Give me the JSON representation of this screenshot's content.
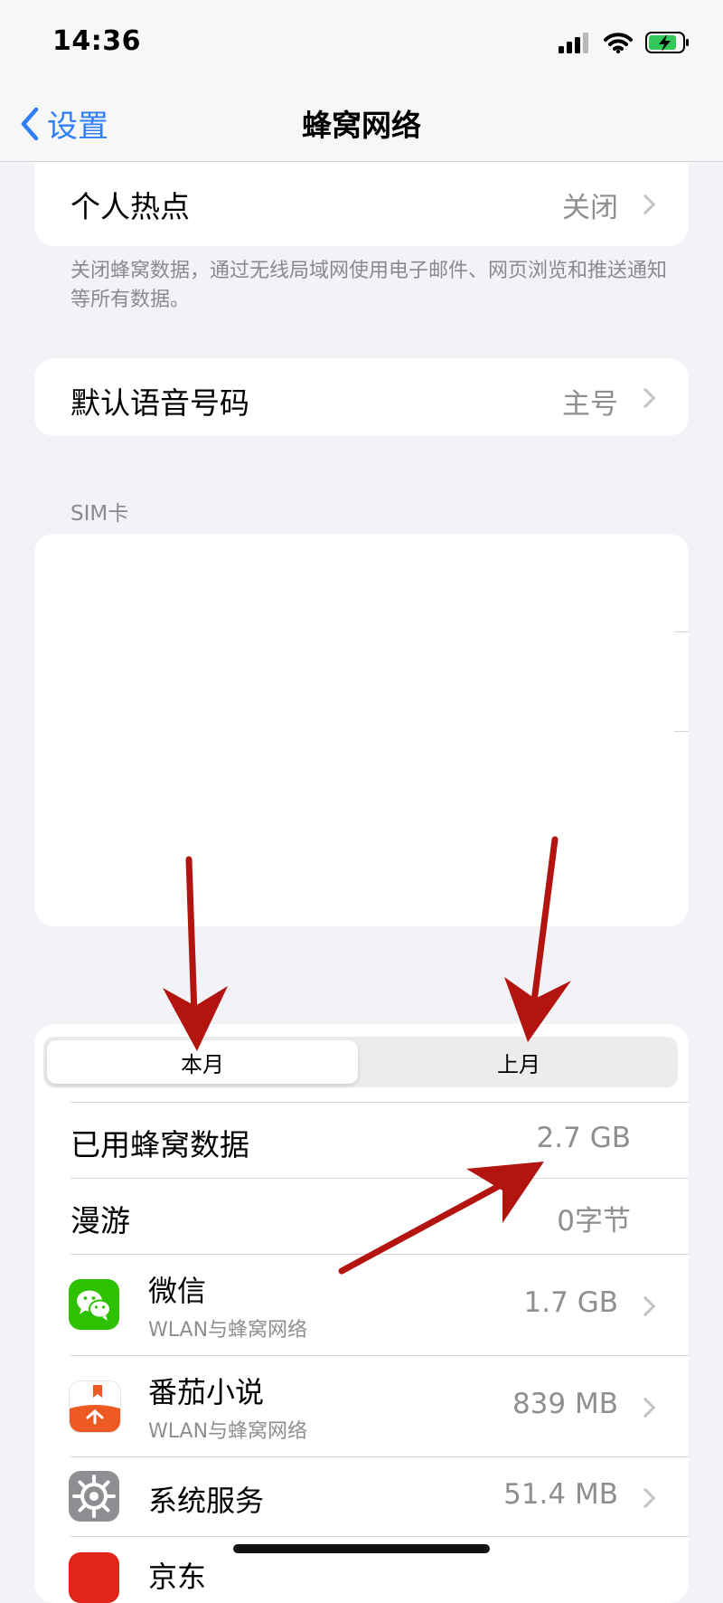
{
  "status_bar": {
    "time": "14:36"
  },
  "nav": {
    "back_label": "设置",
    "title": "蜂窝网络"
  },
  "hotspot": {
    "label": "个人热点",
    "value": "关闭"
  },
  "cellular_footnote": "关闭蜂窝数据，通过无线局域网使用电子邮件、网页浏览和推送通知等所有数据。",
  "voice": {
    "label": "默认语音号码",
    "value": "主号"
  },
  "sim_section": {
    "header": "SIM卡"
  },
  "usage": {
    "tabs": [
      {
        "label": "本月",
        "selected": true
      },
      {
        "label": "上月",
        "selected": false
      }
    ],
    "used": {
      "label": "已用蜂窝数据",
      "value": "2.7 GB"
    },
    "roaming": {
      "label": "漫游",
      "value": "0字节"
    },
    "apps": [
      {
        "name": "微信",
        "subtitle": "WLAN与蜂窝网络",
        "usage": "1.7 GB",
        "icon": "wechat-icon"
      },
      {
        "name": "番茄小说",
        "subtitle": "WLAN与蜂窝网络",
        "usage": "839 MB",
        "icon": "tomato-novel-icon"
      },
      {
        "name": "系统服务",
        "subtitle": "",
        "usage": "51.4 MB",
        "icon": "gear-icon"
      },
      {
        "name": "京东",
        "subtitle": "",
        "usage": "",
        "icon": "jd-icon"
      }
    ]
  },
  "colors": {
    "accent": "#2f7ef6",
    "annotation_arrow": "#b3140f",
    "wechat_green": "#2dc100"
  }
}
